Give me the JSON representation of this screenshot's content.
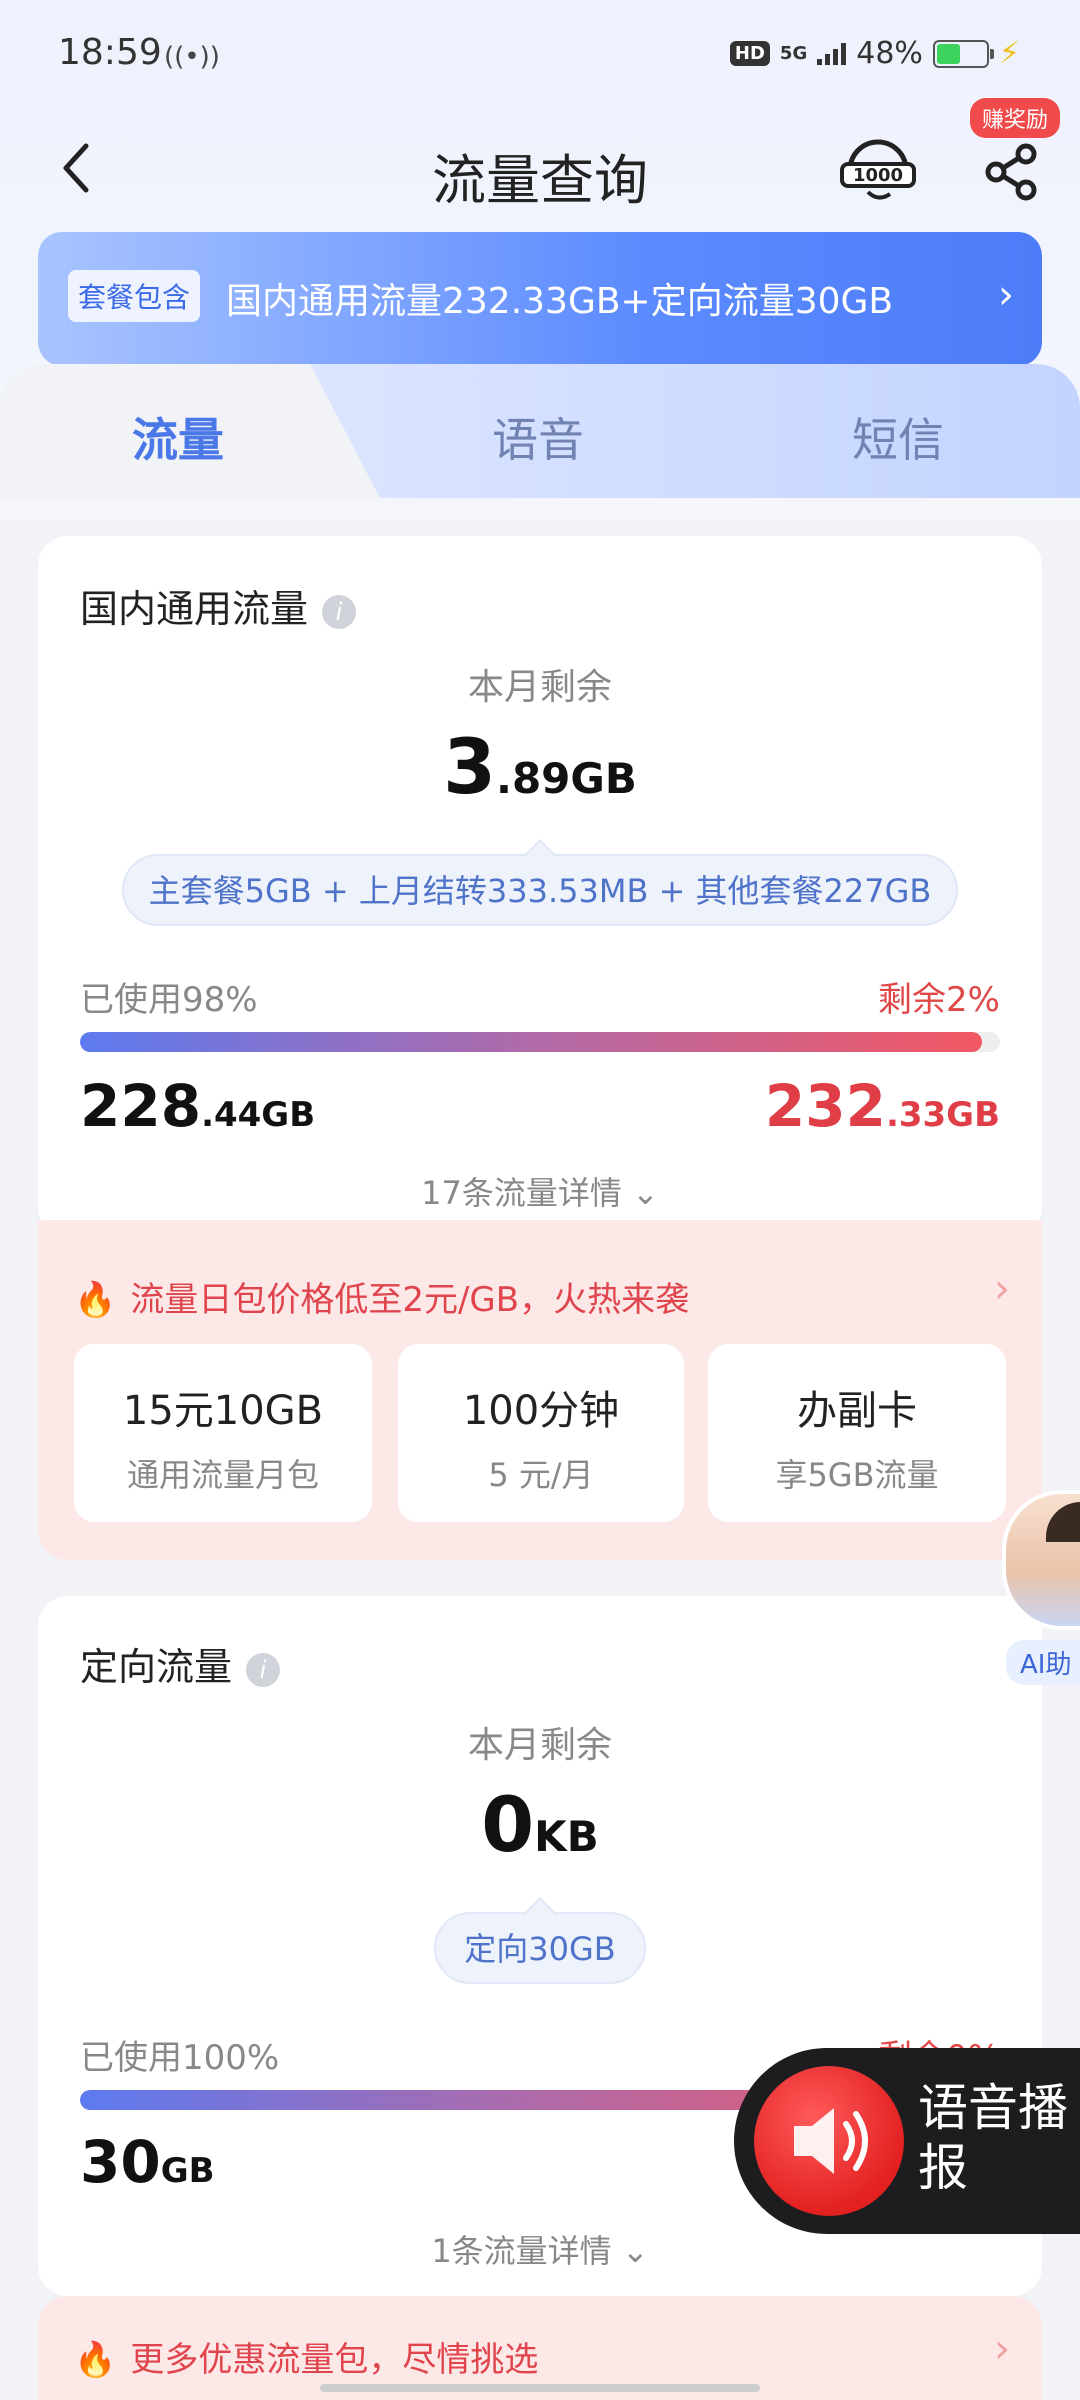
{
  "status": {
    "time": "18:59",
    "hd": "HD",
    "net": "5G",
    "battery": "48%"
  },
  "nav": {
    "title": "流量查询",
    "reward": "赚奖励"
  },
  "banner": {
    "tag": "套餐包含",
    "text": "国内通用流量232.33GB+定向流量30GB"
  },
  "tabs": [
    {
      "label": "流量"
    },
    {
      "label": "语音"
    },
    {
      "label": "短信"
    }
  ],
  "general": {
    "title": "国内通用流量",
    "remain_label": "本月剩余",
    "remain_int": "3",
    "remain_unit": ".89GB",
    "breakdown": "主套餐5GB + 上月结转333.53MB + 其他套餐227GB",
    "used_label": "已使用98%",
    "left_label": "剩余2%",
    "used_fraction": 0.98,
    "used_int": "228",
    "used_unit": ".44GB",
    "total_int": "232",
    "total_unit": ".33GB",
    "detail": "17条流量详情"
  },
  "promo": {
    "text": "流量日包价格低至2元/GB，火热来袭",
    "offers": [
      {
        "title": "15元10GB",
        "sub": "通用流量月包"
      },
      {
        "title": "100分钟",
        "sub": "5 元/月"
      },
      {
        "title": "办副卡",
        "sub": "享5GB流量"
      }
    ]
  },
  "directed": {
    "title": "定向流量",
    "remain_label": "本月剩余",
    "remain_int": "0",
    "remain_unit": "KB",
    "breakdown": "定向30GB",
    "used_label": "已使用100%",
    "left_label": "剩余0%",
    "used_fraction": 1.0,
    "used_int": "30",
    "used_unit": "GB",
    "detail": "1条流量详情"
  },
  "promo2": {
    "text": "更多优惠流量包，尽情挑选"
  },
  "ai": {
    "label": "AI助"
  },
  "voice": {
    "label": "语音播报"
  }
}
